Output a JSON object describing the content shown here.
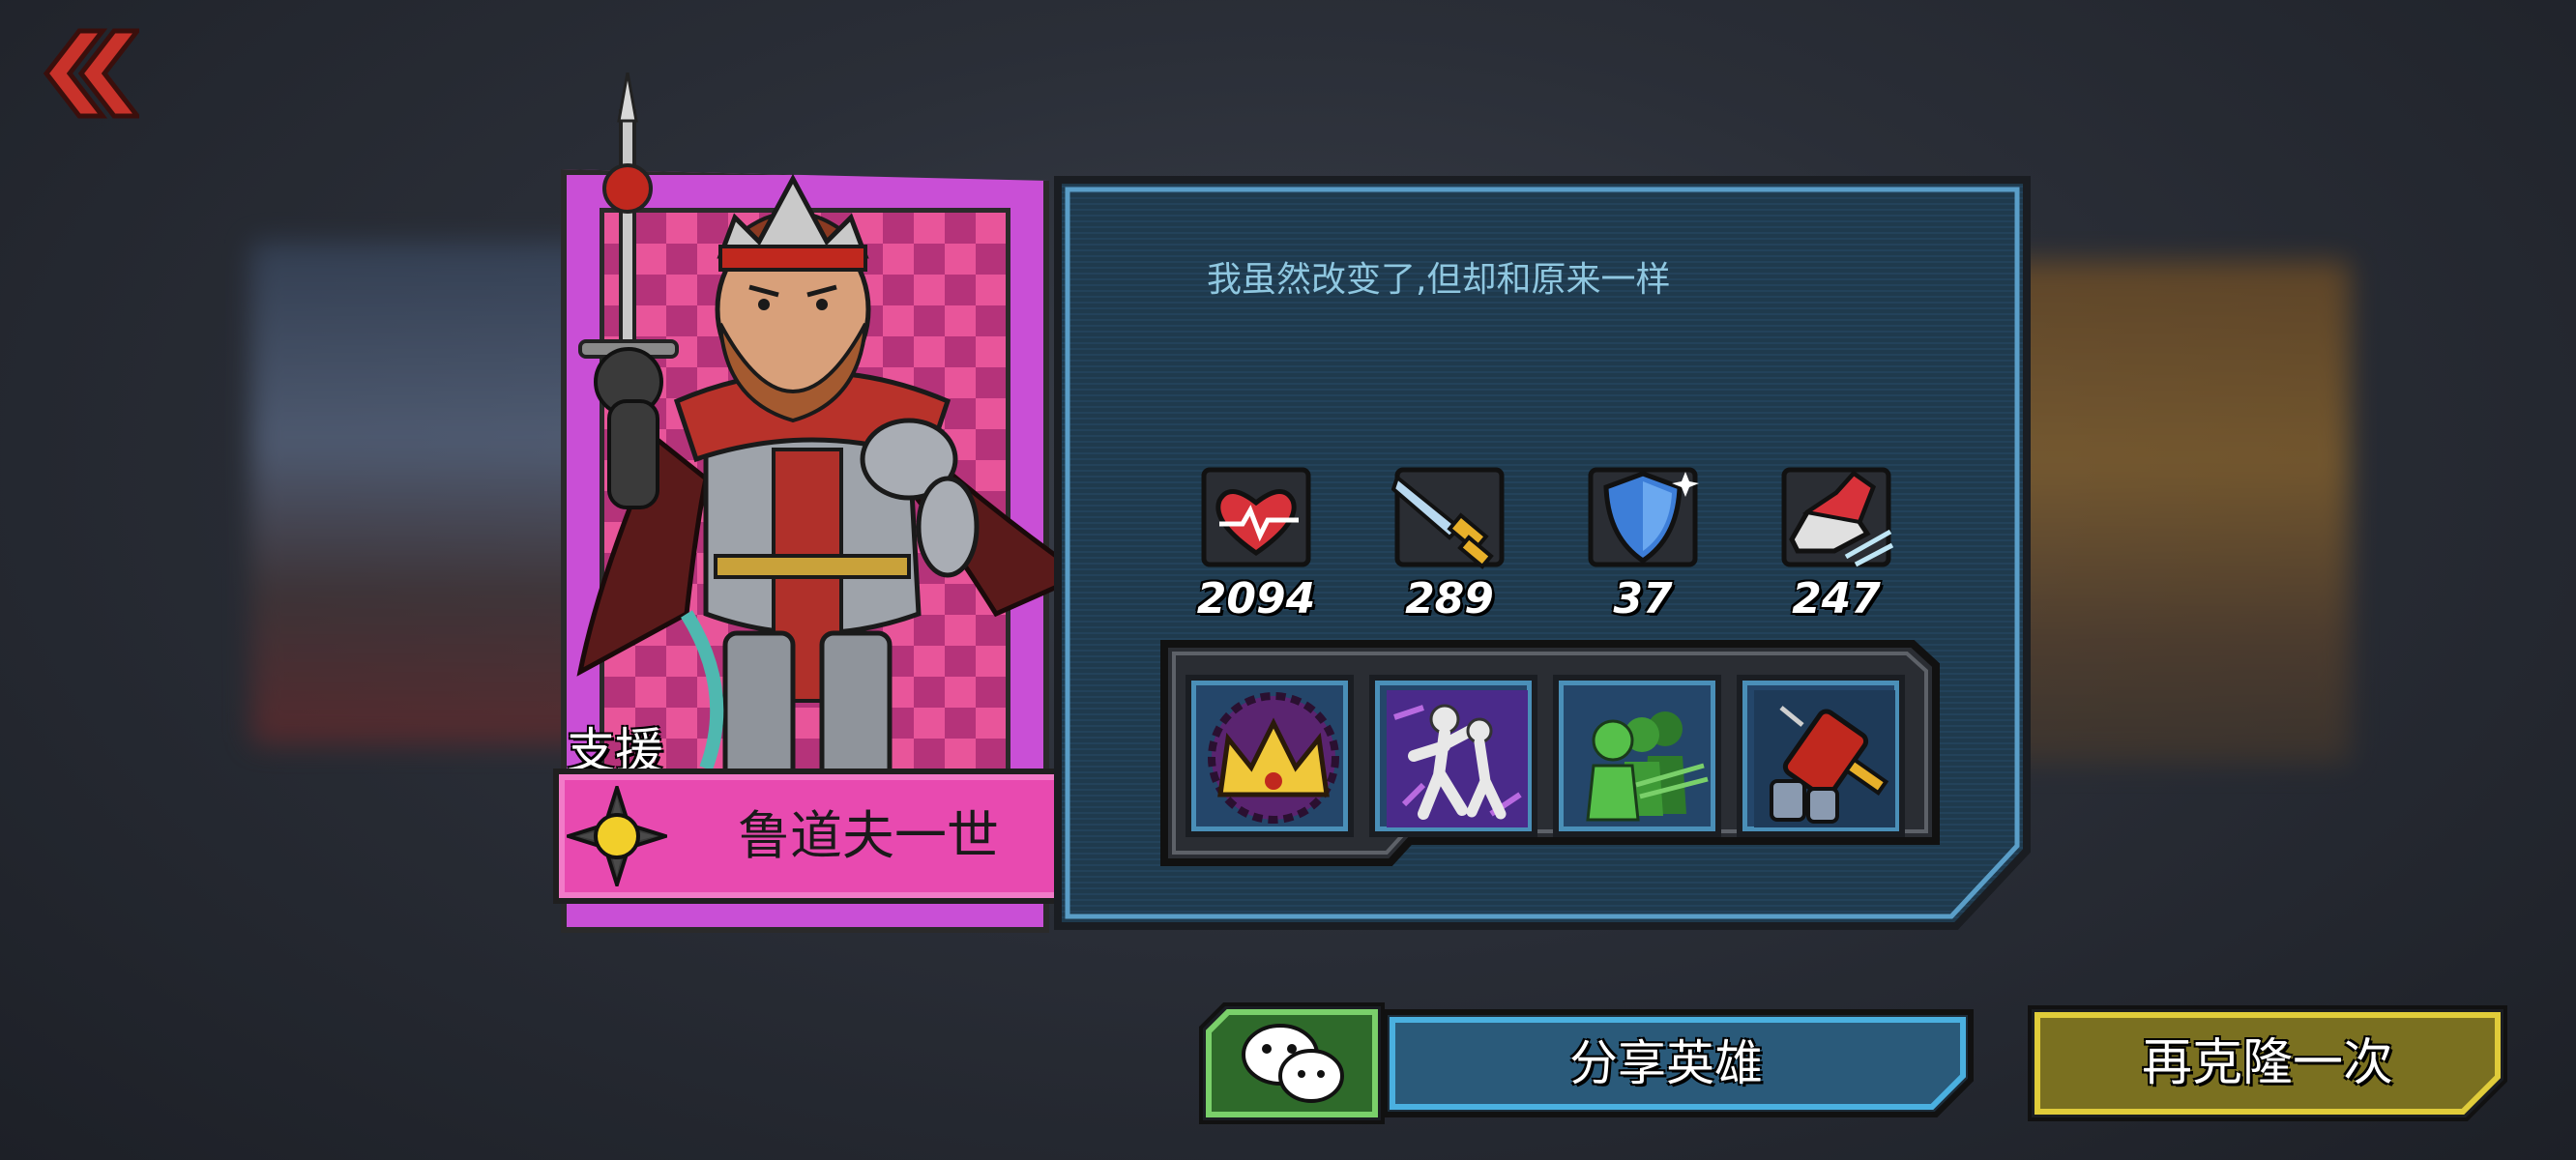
{
  "hero": {
    "role": "支援",
    "name": "鲁道夫一世",
    "quote": "我虽然改变了,但却和原来一样"
  },
  "stats": [
    {
      "name": "health",
      "icon": "heart-icon",
      "value": "2094"
    },
    {
      "name": "attack",
      "icon": "sword-icon",
      "value": "289"
    },
    {
      "name": "defense",
      "icon": "shield-icon",
      "value": "37"
    },
    {
      "name": "speed",
      "icon": "sneaker-icon",
      "value": "247"
    }
  ],
  "skills": [
    {
      "icon": "crown-skill-icon"
    },
    {
      "icon": "dancing-statue-skill-icon"
    },
    {
      "icon": "team-silhouettes-skill-icon"
    },
    {
      "icon": "potion-syringe-skill-icon"
    }
  ],
  "buttons": {
    "share_label": "分享英雄",
    "clone_label": "再克隆一次"
  },
  "colors": {
    "card_pink": "#e84ab0",
    "panel_blue": "#203a4e",
    "panel_border": "#6aa8d0",
    "share_blue": "#2a5a7a",
    "wechat_green": "#2e6a2a",
    "clone_gold": "#7a7020"
  }
}
